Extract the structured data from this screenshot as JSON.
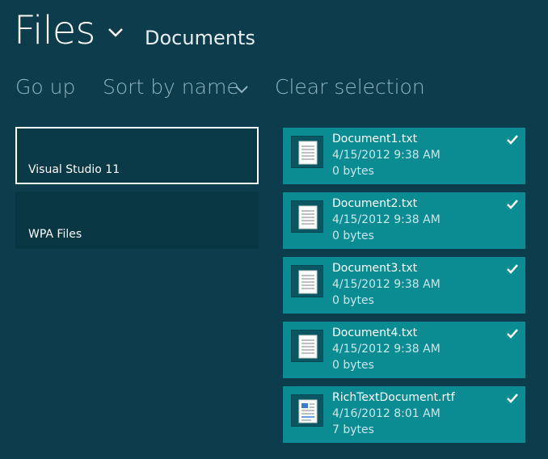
{
  "header": {
    "title": "Files",
    "location": "Documents"
  },
  "commands": {
    "go_up": "Go up",
    "sort": "Sort by name",
    "clear": "Clear selection"
  },
  "folders": [
    {
      "name": "Visual Studio 11",
      "selected": true
    },
    {
      "name": "WPA Files",
      "selected": false
    }
  ],
  "files": [
    {
      "name": "Document1.txt",
      "date": "4/15/2012 9:38 AM",
      "size": "0 bytes",
      "icon": "text-document-icon",
      "selected": true
    },
    {
      "name": "Document2.txt",
      "date": "4/15/2012 9:38 AM",
      "size": "0 bytes",
      "icon": "text-document-icon",
      "selected": true
    },
    {
      "name": "Document3.txt",
      "date": "4/15/2012 9:38 AM",
      "size": "0 bytes",
      "icon": "text-document-icon",
      "selected": true
    },
    {
      "name": "Document4.txt",
      "date": "4/15/2012 9:38 AM",
      "size": "0 bytes",
      "icon": "text-document-icon",
      "selected": true
    },
    {
      "name": "RichTextDocument.rtf",
      "date": "4/16/2012 8:01 AM",
      "size": "7 bytes",
      "icon": "rich-text-document-icon",
      "selected": true
    }
  ],
  "colors": {
    "background": "#0d3d4c",
    "tile": "#0b8c93",
    "folder": "#083743",
    "command_text": "#8fb4bf"
  }
}
